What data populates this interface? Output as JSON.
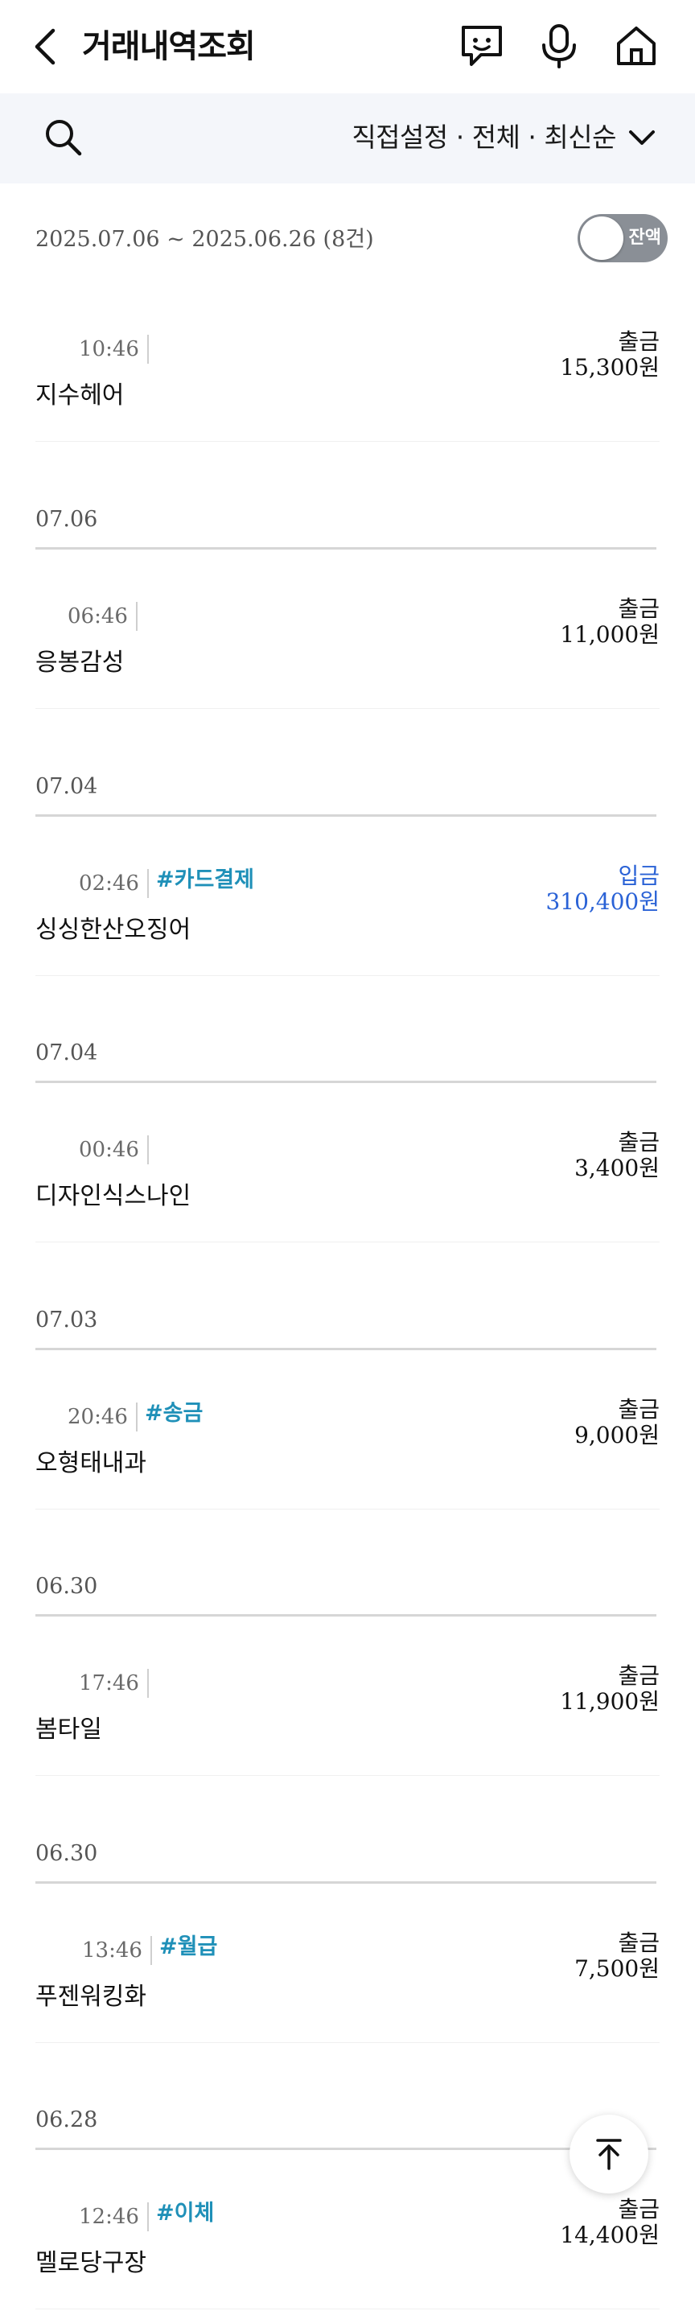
{
  "header": {
    "title": "거래내역조회"
  },
  "filter": {
    "label": "직접설정 · 전체 · 최신순"
  },
  "summary": {
    "range": "2025.07.06 ~ 2025.06.26 (8건)",
    "toggle_label": "잔액"
  },
  "transactions": [
    {
      "date": "",
      "time": "10:46",
      "tag": "",
      "merchant": "지수헤어",
      "direction": "출금",
      "amount": "15,300원",
      "type": "out"
    },
    {
      "date": "07.06",
      "time": "06:46",
      "tag": "",
      "merchant": "응봉감성",
      "direction": "출금",
      "amount": "11,000원",
      "type": "out"
    },
    {
      "date": "07.04",
      "time": "02:46",
      "tag": "#카드결제",
      "merchant": "싱싱한산오징어",
      "direction": "입금",
      "amount": "310,400원",
      "type": "in"
    },
    {
      "date": "07.04",
      "time": "00:46",
      "tag": "",
      "merchant": "디자인식스나인",
      "direction": "출금",
      "amount": "3,400원",
      "type": "out"
    },
    {
      "date": "07.03",
      "time": "20:46",
      "tag": "#송금",
      "merchant": "오형태내과",
      "direction": "출금",
      "amount": "9,000원",
      "type": "out"
    },
    {
      "date": "06.30",
      "time": "17:46",
      "tag": "",
      "merchant": "봄타일",
      "direction": "출금",
      "amount": "11,900원",
      "type": "out"
    },
    {
      "date": "06.30",
      "time": "13:46",
      "tag": "#월급",
      "merchant": "푸젠워킹화",
      "direction": "출금",
      "amount": "7,500원",
      "type": "out"
    },
    {
      "date": "06.28",
      "time": "12:46",
      "tag": "#이체",
      "merchant": "멜로당구장",
      "direction": "출금",
      "amount": "14,400원",
      "type": "out"
    }
  ],
  "colors": {
    "in": "#2a62d6",
    "tag": "#1f90b8",
    "filter_bg": "#f4f6fa"
  }
}
